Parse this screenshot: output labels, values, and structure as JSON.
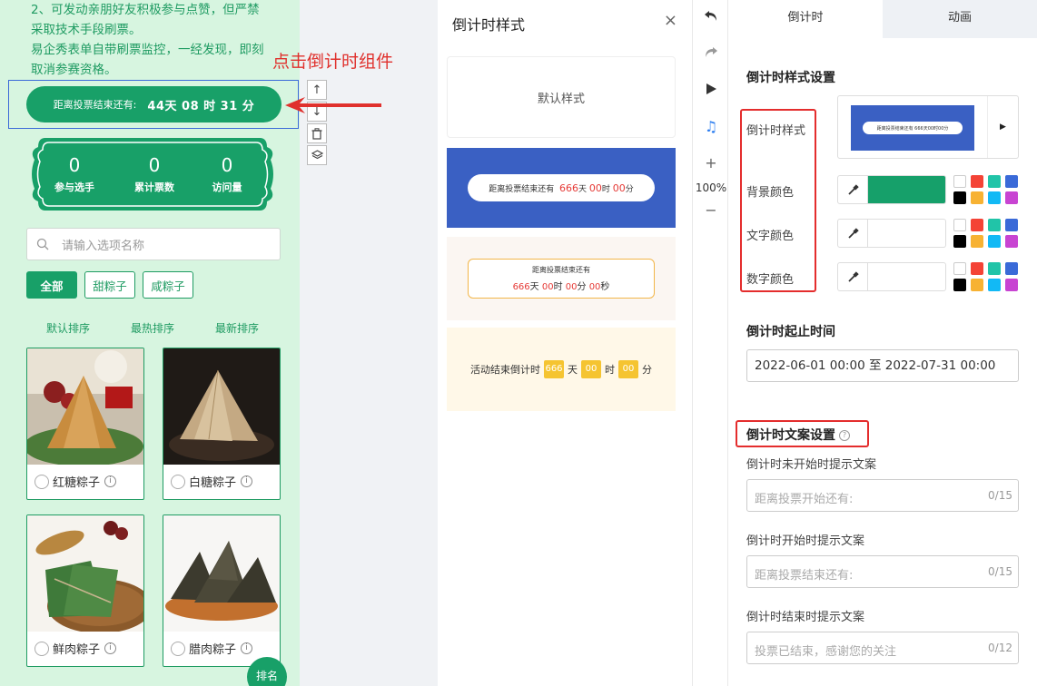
{
  "preview": {
    "notice_lines": [
      "2、可发动亲朋好友积极参与点赞，但严禁",
      "采取技术手段刷票。",
      "易企秀表单自带刷票监控，一经发现，即刻",
      "取消参赛资格。"
    ],
    "countdown": {
      "prefix": "距离投票结束还有:",
      "value": "44天 08 时 31 分"
    },
    "annotation": "点击倒计时组件",
    "stats": [
      {
        "value": "0",
        "label": "参与选手"
      },
      {
        "value": "0",
        "label": "累计票数"
      },
      {
        "value": "0",
        "label": "访问量"
      }
    ],
    "search_placeholder": "请输入选项名称",
    "categories": [
      "全部",
      "甜粽子",
      "咸粽子"
    ],
    "sorts": [
      "默认排序",
      "最热排序",
      "最新排序"
    ],
    "cards": [
      {
        "name": "红糖粽子"
      },
      {
        "name": "白糖粽子"
      },
      {
        "name": "鲜肉粽子"
      },
      {
        "name": "腊肉粽子"
      }
    ],
    "rank_label": "排名",
    "bottom_text": "___"
  },
  "style_panel": {
    "title": "倒计时样式",
    "close": "×",
    "default_label": "默认样式",
    "blue": {
      "prefix": "距离投票结束还有",
      "n1": "666",
      "u1": "天",
      "n2": "00",
      "u2": "时",
      "n3": "00",
      "u3": "分"
    },
    "orange": {
      "line1": "距离投票结束还有",
      "n1": "666",
      "u1": "天",
      "n2": "00",
      "u2": "时",
      "n3": "00",
      "u3": "分",
      "n4": "00",
      "u4": "秒"
    },
    "yellow": {
      "prefix": "活动结束倒计时",
      "n1": "666",
      "u1": "天",
      "n2": "00",
      "u2": "时",
      "n3": "00",
      "u3": "分"
    }
  },
  "toolstrip": {
    "zoom": "100%"
  },
  "settings": {
    "tabs": [
      "倒计时",
      "动画"
    ],
    "style_section": "倒计时样式设置",
    "style_label": "倒计时样式",
    "preview_text": "距离投票结束还有 666天00时00分",
    "bg_label": "背景颜色",
    "text_label": "文字颜色",
    "num_label": "数字颜色",
    "bg_color": "#16a06a",
    "palette": [
      "#ffffff",
      "#f44336",
      "#21c4a8",
      "#3a6ad8",
      "#000000",
      "#f7b233",
      "#12b9f5",
      "#c844d2"
    ],
    "time_section": "倒计时起止时间",
    "time_range": "2022-06-01 00:00 至 2022-07-31 00:00",
    "copy_section": "倒计时文案设置",
    "fields": [
      {
        "label": "倒计时未开始时提示文案",
        "placeholder": "距离投票开始还有:",
        "count": "0/15"
      },
      {
        "label": "倒计时开始时提示文案",
        "placeholder": "距离投票结束还有:",
        "count": "0/15"
      },
      {
        "label": "倒计时结束时提示文案",
        "placeholder": "投票已结束，感谢您的关注",
        "count": "0/12"
      }
    ]
  }
}
